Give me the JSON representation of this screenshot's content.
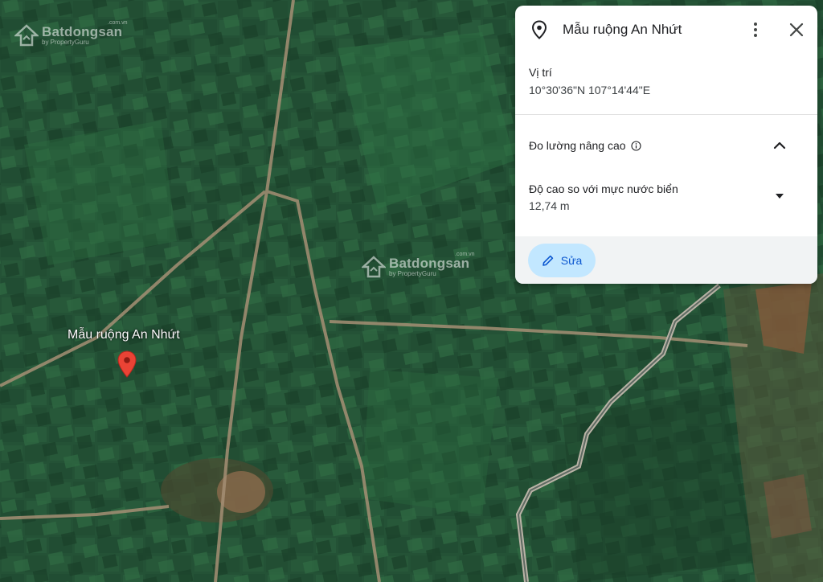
{
  "watermark": {
    "brand": "Batdongsan",
    "sub": "by PropertyGuru",
    "domain": ".com.vn"
  },
  "map": {
    "placemark_label": "Mẫu ruộng An Nhứt"
  },
  "panel": {
    "title": "Mẫu ruộng An Nhứt",
    "location_label": "Vị trí",
    "coordinates": "10°30'36\"N 107°14'44\"E",
    "advanced_label": "Đo lường nâng cao",
    "elevation_label": "Độ cao so với mực nước biển",
    "elevation_value": "12,74 m",
    "edit_label": "Sửa"
  },
  "colors": {
    "pin": "#ea4335",
    "button_bg": "#c2e7ff",
    "button_text": "#0b57d0",
    "field_dark": "#1f4a2c",
    "road": "#a58f74"
  },
  "icons": [
    "location-pin-icon",
    "more-vert-icon",
    "close-icon",
    "info-icon",
    "chevron-up-icon",
    "caret-down-icon",
    "pencil-icon",
    "map-marker-icon"
  ]
}
